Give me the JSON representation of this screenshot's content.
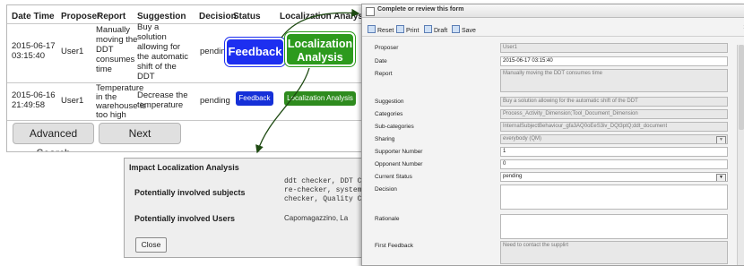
{
  "table": {
    "headers": [
      "Date Time",
      "Proposer",
      "Report",
      "Suggestion",
      "Decision",
      "Status",
      "Localization Analysis"
    ],
    "rows": [
      {
        "date": "2015-06-17",
        "time": "03:15:40",
        "proposer": "User1",
        "report": [
          "Manually",
          "moving the",
          "DDT",
          "consumes",
          "time"
        ],
        "suggestion": [
          "Buy a",
          "solution",
          "allowing for",
          "the automatic",
          "shift of the",
          "DDT"
        ],
        "decision": "pending",
        "status_btn": "Feedback",
        "loc_btn": "Localization Analysis"
      },
      {
        "date": "2015-06-16",
        "time": "21:49:58",
        "proposer": "User1",
        "report": [
          "Temperature",
          "in the",
          "warehouse is",
          "too high"
        ],
        "suggestion": [
          "Decrease the",
          "temperature"
        ],
        "decision": "pending",
        "status_btn": "Feedback",
        "loc_btn": "Localization Analysis"
      }
    ],
    "advanced_search": "Advanced Search",
    "next": "Next"
  },
  "callouts": {
    "feedback": "Feedback",
    "loc_line1": "Localization",
    "loc_line2": "Analysis"
  },
  "impact": {
    "title": "Impact Localization Analysis",
    "subjects_label": "Potentially involved subjects",
    "subjects_value": [
      "ddt checker, DDT C",
      "re-checker, system",
      "checker, Quality Ch"
    ],
    "users_label": "Potentially involved Users",
    "users_value": "Capomagazzino, La",
    "close": "Close"
  },
  "form": {
    "title": "Complete or review this form",
    "toolbar": {
      "reset": "Reset",
      "print": "Print",
      "draft": "Draft",
      "save": "Save"
    },
    "close_x": "x",
    "fields": {
      "proposer": {
        "label": "Proposer",
        "value": "User1"
      },
      "date": {
        "label": "Date",
        "value": "2015-06-17 03:15:40"
      },
      "report": {
        "label": "Report",
        "value": "Manually moving the DDT consumes time"
      },
      "suggestion": {
        "label": "Suggestion",
        "value": "Buy a solution allowing for the automatic shift of the DDT"
      },
      "categories": {
        "label": "Categories",
        "value": "Process_Activity_Dimension;Tool_Document_Dimension"
      },
      "subcategories": {
        "label": "Sub-categories",
        "value": "InternalSubjectBehaviour_gfa3AQ0oEeS3iv_DQt3ptQ;ddt_document"
      },
      "sharing": {
        "label": "Sharing",
        "value": "everybody (QM)"
      },
      "supporter": {
        "label": "Supporter Number",
        "value": "1"
      },
      "opponent": {
        "label": "Opponent Number",
        "value": "0"
      },
      "status": {
        "label": "Current Status",
        "value": "pending"
      },
      "decision": {
        "label": "Decision",
        "value": ""
      },
      "rationale": {
        "label": "Rationale",
        "value": ""
      },
      "first_feedback": {
        "label": "First Feedback",
        "value": "Need to contact the supplirt"
      }
    }
  },
  "colors": {
    "feedback_blue": "#1d2ff0",
    "loc_green": "#2d9a1d",
    "arrow": "#1e4a12"
  }
}
